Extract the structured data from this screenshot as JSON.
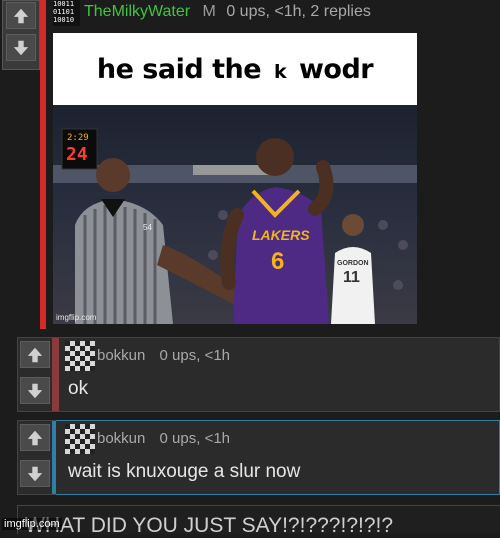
{
  "post": {
    "username": "TheMilkyWater",
    "badge": "M",
    "meta": "0 ups, <1h, 2 replies",
    "avatar_lines": [
      "10011",
      "01101",
      "10010"
    ],
    "meme": {
      "caption": "he said the",
      "caption_small_k": "k",
      "caption_end": "wodr",
      "scoreboard_time": "2:29",
      "scoreboard_shot": "24",
      "player_team": "LAKERS",
      "player_number": "6",
      "opponent_name": "GORDON",
      "opponent_number": "11",
      "ref_number": "54",
      "watermark": "imgflip.com"
    }
  },
  "comments": [
    {
      "username": "bokkun",
      "meta": "0 ups, <1h",
      "text": "ok"
    },
    {
      "username": "bokkun",
      "meta": "0 ups, <1h",
      "text": "wait is knuxouge a slur now"
    },
    {
      "text": "WHAT DID YOU JUST SAY!?!???!?!?!?"
    }
  ],
  "footer": {
    "watermark": "imgflip.com"
  },
  "colors": {
    "post_accent": "#d62a2a",
    "comment_accent": "#8a3a3a",
    "active_comment_border": "#2f7fa8",
    "username_green": "#3ec63e"
  },
  "icons": [
    "arrow-up-icon",
    "arrow-down-icon",
    "checker-avatar-icon"
  ]
}
